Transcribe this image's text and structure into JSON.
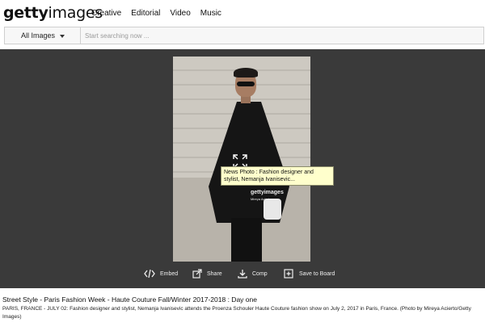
{
  "brand": {
    "bold": "getty",
    "light": "images"
  },
  "nav": [
    "Creative",
    "Editorial",
    "Video",
    "Music"
  ],
  "search": {
    "filter_label": "All Images",
    "placeholder": "Start searching now ..."
  },
  "photo": {
    "watermark": "gettyimages",
    "watermark_credit": "Mireya Acierto"
  },
  "tooltip": "News Photo : Fashion designer and stylist, Nemanja Ivanisevic...",
  "actions": {
    "embed": "Embed",
    "share": "Share",
    "comp": "Comp",
    "save": "Save to Board"
  },
  "caption": {
    "title": "Street Style - Paris Fashion Week - Haute Couture Fall/Winter 2017-2018 : Day one",
    "body": "PARIS, FRANCE - JULY 02: Fashion designer and stylist, Nemanja Ivanisevic attends the Proenza Schouler Haute Couture fashion show on July 2, 2017 in Paris, France. (Photo by Mireya Acierto/Getty Images)"
  },
  "colors": {
    "viewer_bg": "#3a3a3a",
    "tooltip_bg": "#ffffcc"
  },
  "icons": [
    "embed-icon",
    "share-icon",
    "download-icon",
    "add-to-board-icon",
    "expand-icon",
    "caret-down-icon"
  ]
}
